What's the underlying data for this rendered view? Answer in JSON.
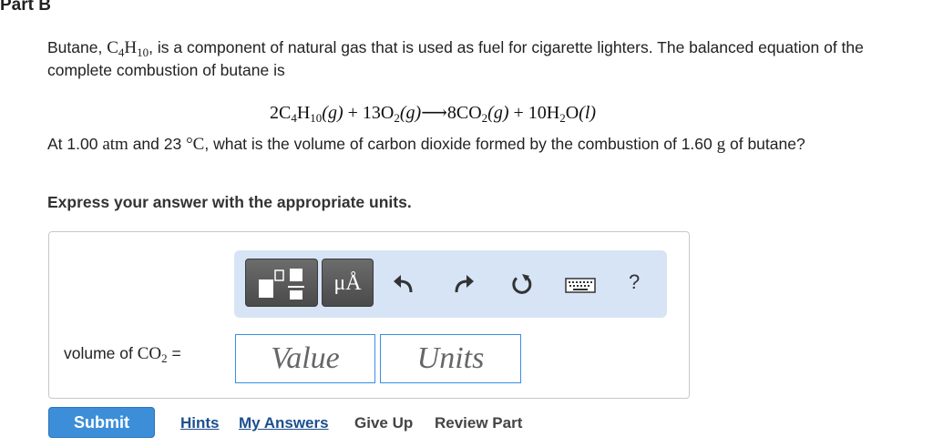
{
  "part_title": "Part B",
  "intro": {
    "before_formula": "Butane, ",
    "formula_c": "C",
    "formula_c_sub": "4",
    "formula_h": "H",
    "formula_h_sub": "10",
    "after_formula": ", is a component of natural gas that is used as fuel for cigarette lighters. The balanced equation of the complete combustion of butane is"
  },
  "equation": {
    "t1": "2C",
    "s1": "4",
    "t2": "H",
    "s2": "10",
    "t3": "(g)",
    "t4": " + 13O",
    "s4": "2",
    "t5": "(g)",
    "t6": "⟶8CO",
    "s6": "2",
    "t7": "(g)",
    "t8": " + 10H",
    "s8": "2",
    "t9": "O",
    "t10": "(l)"
  },
  "question": {
    "p1": "At 1.00 ",
    "atm": "atm",
    "p2": " and 23 ",
    "deg": "°C",
    "p3": ", what is the volume of carbon dioxide formed by the combustion of 1.60 ",
    "g": "g",
    "p4": " of butane?"
  },
  "instruction": "Express your answer with the appropriate units.",
  "toolbar": {
    "units_label": "μÅ",
    "help_label": "?",
    "icons": [
      "templates-icon",
      "undo-icon",
      "redo-icon",
      "reset-icon",
      "keyboard-icon",
      "help-icon"
    ]
  },
  "answer": {
    "label_text": "volume of ",
    "label_co": "CO",
    "label_sub": "2",
    "label_eq": " =",
    "value_placeholder": "Value",
    "units_placeholder": "Units"
  },
  "actions": {
    "submit": "Submit",
    "hints": "Hints",
    "my_answers": "My Answers",
    "give_up": "Give Up",
    "review_part": "Review Part"
  },
  "colors": {
    "toolbar_bg": "#d6e4f6",
    "submit_bg": "#3d8ed9",
    "input_border": "#3b8ee0",
    "link": "#1d4f8e"
  }
}
